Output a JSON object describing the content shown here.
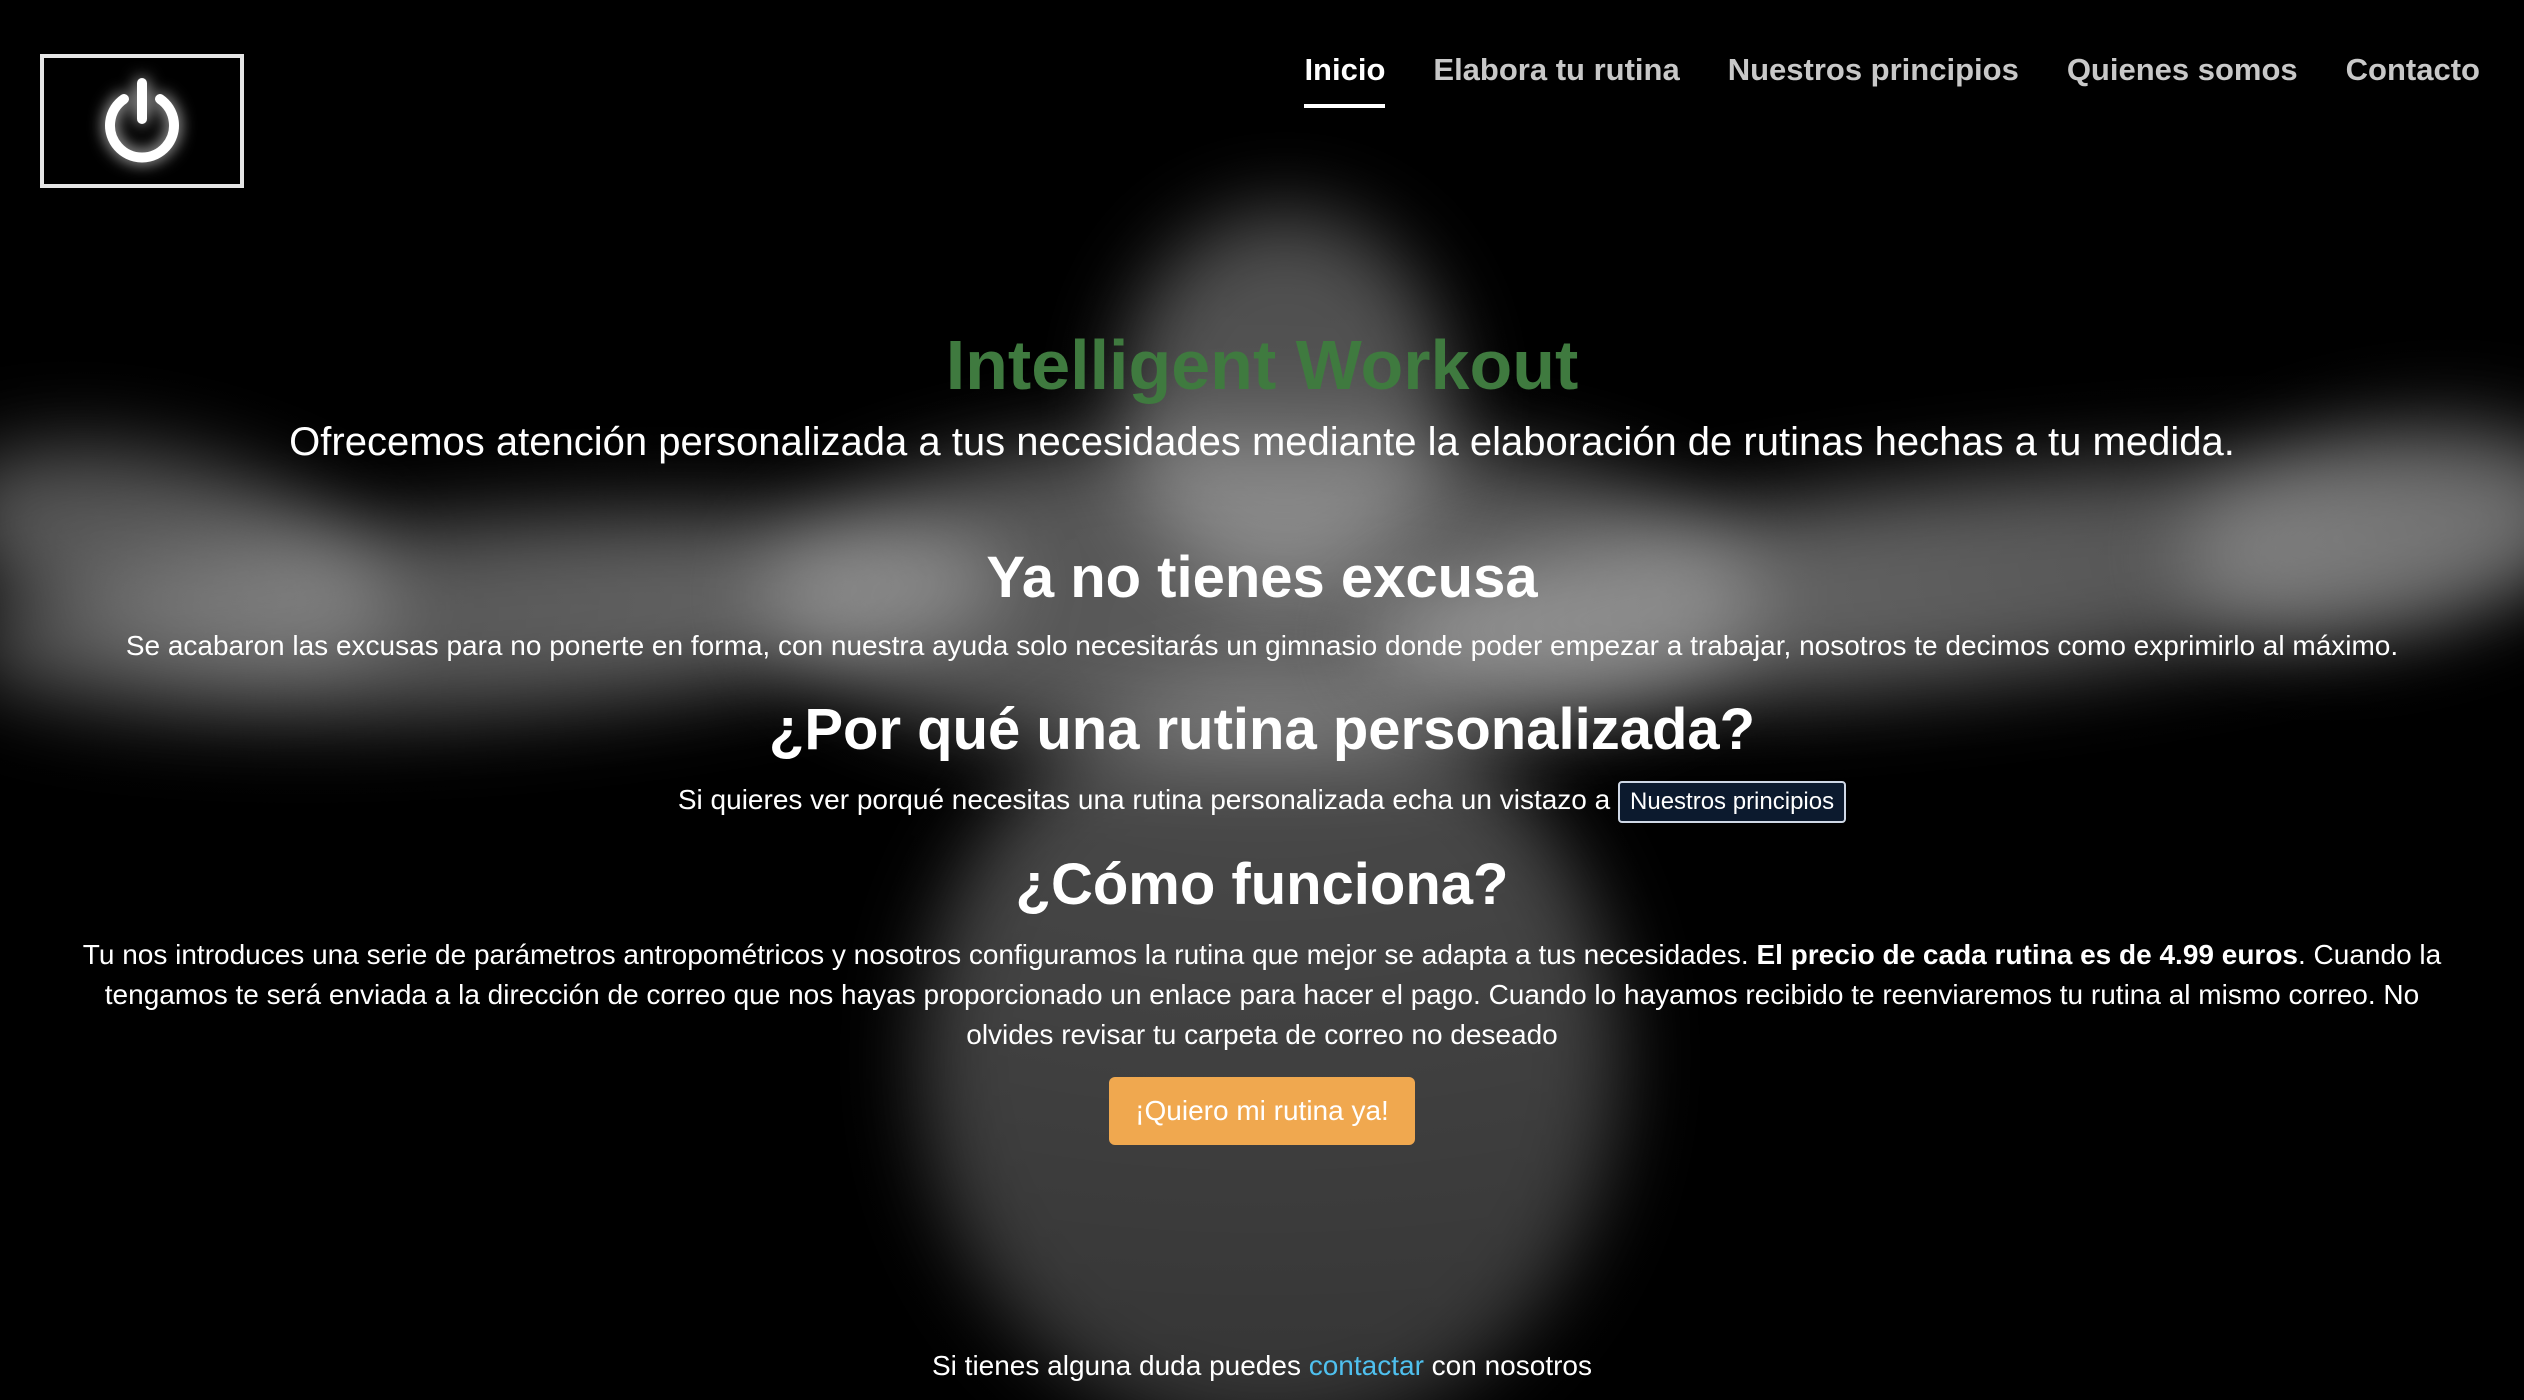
{
  "nav": {
    "items": [
      {
        "label": "Inicio",
        "active": true
      },
      {
        "label": "Elabora tu rutina",
        "active": false
      },
      {
        "label": "Nuestros principios",
        "active": false
      },
      {
        "label": "Quienes somos",
        "active": false
      },
      {
        "label": "Contacto",
        "active": false
      }
    ]
  },
  "logo": {
    "icon": "power-icon"
  },
  "hero": {
    "title": "Intelligent Workout",
    "subtitle": "Ofrecemos atención personalizada a tus necesidades mediante la elaboración de rutinas hechas a tu medida."
  },
  "sections": {
    "excusa": {
      "title": "Ya no tienes excusa",
      "text": "Se acabaron las excusas para no ponerte en forma, con nuestra ayuda solo necesitarás un gimnasio donde poder empezar a trabajar, nosotros te decimos como exprimirlo al máximo."
    },
    "personalizada": {
      "title": "¿Por qué una rutina personalizada?",
      "text": "Si quieres ver porqué necesitas una rutina personalizada echa un vistazo a",
      "link_label": "Nuestros principios"
    },
    "funciona": {
      "title": "¿Cómo funciona?",
      "text_before": "Tu nos introduces una serie de parámetros antropométricos y nosotros configuramos la rutina que mejor se adapta a tus necesidades. ",
      "text_bold": "El precio de cada rutina es de 4.99 euros",
      "text_after": ". Cuando la tengamos te será enviada a la dirección de correo que nos hayas proporcionado un enlace para hacer el pago. Cuando lo hayamos recibido te reenviaremos tu rutina al mismo correo. No olvides revisar tu carpeta de correo no deseado",
      "cta_label": "¡Quiero mi rutina ya!"
    }
  },
  "footer": {
    "text_before": "Si tienes alguna duda puedes ",
    "link_label": "contactar",
    "text_after": " con nosotros"
  },
  "colors": {
    "title_green": "#3f7a3f",
    "cta_orange": "#f0a84f",
    "link_blue": "#4fc0ee",
    "background": "#000000"
  }
}
